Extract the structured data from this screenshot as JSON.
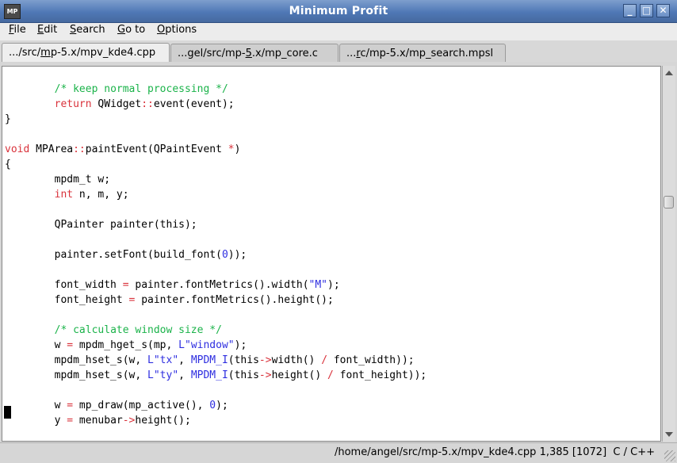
{
  "window": {
    "title": "Minimum Profit",
    "icon_label": "MP",
    "controls": [
      "minimize-icon",
      "maximize-icon",
      "close-icon"
    ],
    "minimize_glyph": "_",
    "maximize_glyph": "□",
    "close_glyph": "✕"
  },
  "menu": {
    "items": [
      {
        "mnemonic": "F",
        "rest": "ile"
      },
      {
        "mnemonic": "E",
        "rest": "dit"
      },
      {
        "mnemonic": "S",
        "rest": "earch"
      },
      {
        "mnemonic": "G",
        "rest": "o to"
      },
      {
        "mnemonic": "O",
        "rest": "ptions"
      }
    ]
  },
  "tabs": [
    {
      "pre": ".../src/",
      "mnemonic": "m",
      "post": "p-5.x/mpv_kde4.cpp",
      "active": true
    },
    {
      "pre": "...gel/src/mp-",
      "mnemonic": "5",
      "post": ".x/mp_core.c",
      "active": false
    },
    {
      "pre": "...",
      "mnemonic": "r",
      "post": "c/mp-5.x/mp_search.mpsl",
      "active": false
    }
  ],
  "editor": {
    "lines": [
      [],
      [
        {
          "t": "        "
        },
        {
          "t": "/* keep normal processing */",
          "c": "cm"
        }
      ],
      [
        {
          "t": "        "
        },
        {
          "t": "return",
          "c": "ty"
        },
        {
          "t": " QWidget"
        },
        {
          "t": "::",
          "c": "op"
        },
        {
          "t": "event(event);"
        }
      ],
      [
        {
          "t": "}"
        }
      ],
      [],
      [
        {
          "t": "void",
          "c": "ty"
        },
        {
          "t": " MPArea"
        },
        {
          "t": "::",
          "c": "op"
        },
        {
          "t": "paintEvent(QPaintEvent "
        },
        {
          "t": "*",
          "c": "op"
        },
        {
          "t": ")"
        }
      ],
      [
        {
          "t": "{"
        }
      ],
      [
        {
          "t": "        mpdm_t w;"
        }
      ],
      [
        {
          "t": "        "
        },
        {
          "t": "int",
          "c": "ty"
        },
        {
          "t": " n, m, y;"
        }
      ],
      [],
      [
        {
          "t": "        QPainter painter(this);"
        }
      ],
      [],
      [
        {
          "t": "        painter.setFont(build_font("
        },
        {
          "t": "0",
          "c": "kw"
        },
        {
          "t": "));"
        }
      ],
      [],
      [
        {
          "t": "        font_width "
        },
        {
          "t": "=",
          "c": "op"
        },
        {
          "t": " painter.fontMetrics().width("
        },
        {
          "t": "\"M\"",
          "c": "str"
        },
        {
          "t": ");"
        }
      ],
      [
        {
          "t": "        font_height "
        },
        {
          "t": "=",
          "c": "op"
        },
        {
          "t": " painter.fontMetrics().height();"
        }
      ],
      [],
      [
        {
          "t": "        "
        },
        {
          "t": "/* calculate window size */",
          "c": "cm"
        }
      ],
      [
        {
          "t": "        w "
        },
        {
          "t": "=",
          "c": "op"
        },
        {
          "t": " mpdm_hget_s(mp, "
        },
        {
          "t": "L\"window\"",
          "c": "str"
        },
        {
          "t": ");"
        }
      ],
      [
        {
          "t": "        mpdm_hset_s(w, "
        },
        {
          "t": "L\"tx\"",
          "c": "str"
        },
        {
          "t": ", "
        },
        {
          "t": "MPDM_I",
          "c": "kw"
        },
        {
          "t": "(this"
        },
        {
          "t": "->",
          "c": "op"
        },
        {
          "t": "width() "
        },
        {
          "t": "/",
          "c": "op"
        },
        {
          "t": " font_width));"
        }
      ],
      [
        {
          "t": "        mpdm_hset_s(w, "
        },
        {
          "t": "L\"ty\"",
          "c": "str"
        },
        {
          "t": ", "
        },
        {
          "t": "MPDM_I",
          "c": "kw"
        },
        {
          "t": "(this"
        },
        {
          "t": "->",
          "c": "op"
        },
        {
          "t": "height() "
        },
        {
          "t": "/",
          "c": "op"
        },
        {
          "t": " font_height));"
        }
      ],
      [],
      [
        {
          "t": "        w "
        },
        {
          "t": "=",
          "c": "op"
        },
        {
          "t": " mp_draw(mp_active(), "
        },
        {
          "t": "0",
          "c": "kw"
        },
        {
          "t": ");"
        }
      ],
      [
        {
          "t": "        y "
        },
        {
          "t": "=",
          "c": "op"
        },
        {
          "t": " menubar"
        },
        {
          "t": "->",
          "c": "op"
        },
        {
          "t": "height();"
        }
      ]
    ]
  },
  "status": {
    "text": "/home/angel/src/mp-5.x/mpv_kde4.cpp 1,385 [1072]  C / C++"
  },
  "colors": {
    "comment": "#1bb34a",
    "keyword": "#2e2ee0",
    "type": "#d9323b",
    "titlebar": "#4f78b6"
  }
}
